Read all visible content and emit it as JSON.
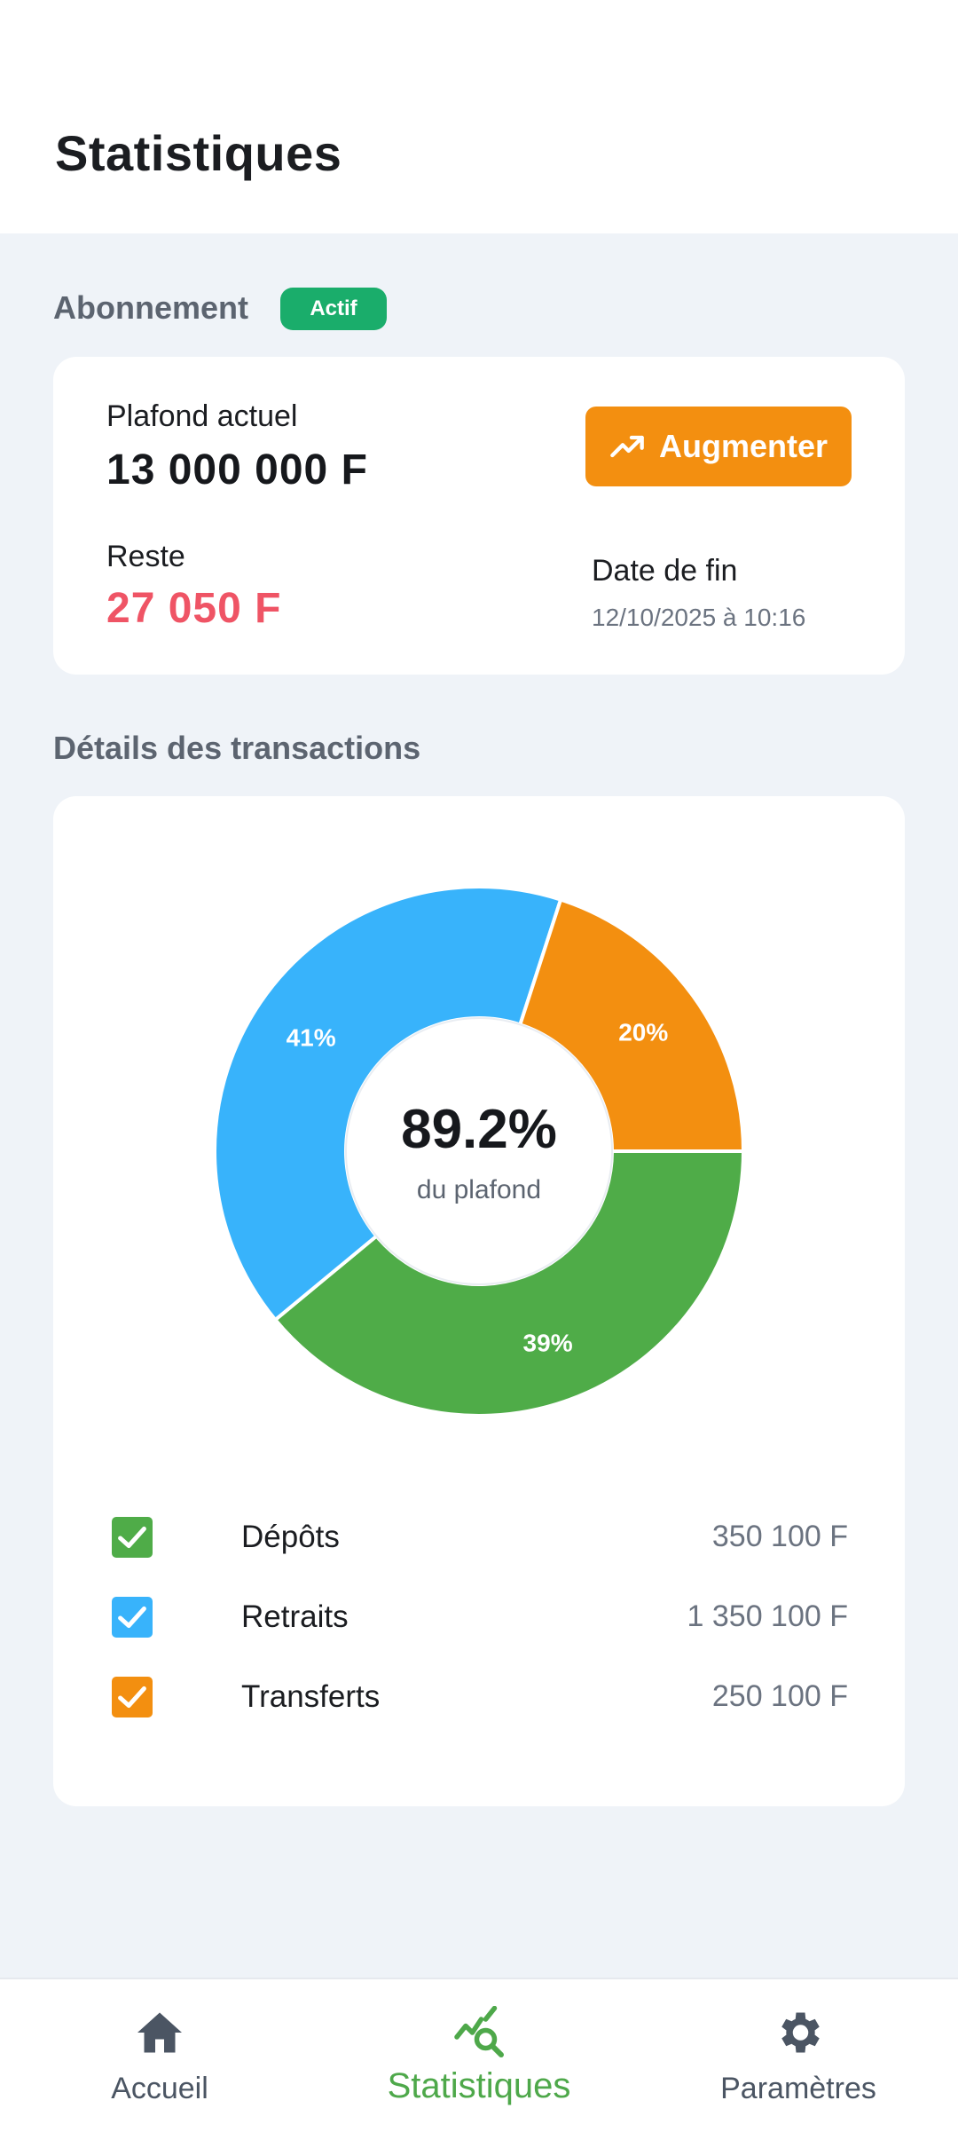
{
  "page": {
    "title": "Statistiques"
  },
  "subscription": {
    "section_title": "Abonnement",
    "status_badge": "Actif",
    "ceiling_label": "Plafond actuel",
    "ceiling_value": "13 000 000 F",
    "remaining_label": "Reste",
    "remaining_value": "27 050 F",
    "button_label": "Augmenter",
    "button_icon": "trending-up-icon",
    "end_date_label": "Date de fin",
    "end_date_value": "12/10/2025 à 10:16"
  },
  "transactions": {
    "section_title": "Détails des transactions",
    "center_value": "89.2%",
    "center_label": "du plafond",
    "legend": [
      {
        "label": "Dépôts",
        "value": "350 100 F",
        "color": "#4fac48",
        "checked": true
      },
      {
        "label": "Retraits",
        "value": "1 350 100 F",
        "color": "#38b3fb",
        "checked": true
      },
      {
        "label": "Transferts",
        "value": "250 100 F",
        "color": "#f38f10",
        "checked": true
      }
    ]
  },
  "chart_data": {
    "type": "pie",
    "donut": true,
    "categories": [
      "Dépôts",
      "Retraits",
      "Transferts"
    ],
    "values": [
      39,
      41,
      20
    ],
    "labels": [
      "39%",
      "41%",
      "20%"
    ],
    "colors": [
      "#4fac48",
      "#38b3fb",
      "#f38f10"
    ],
    "start": "3 o'clock",
    "direction": "clockwise",
    "center_text": "89.2%",
    "center_subtext": "du plafond"
  },
  "bottom_nav": {
    "items": [
      {
        "label": "Accueil",
        "icon": "home-icon",
        "active": false
      },
      {
        "label": "Statistiques",
        "icon": "stats-search-icon",
        "active": true
      },
      {
        "label": "Paramètres",
        "icon": "gear-icon",
        "active": false
      }
    ]
  }
}
